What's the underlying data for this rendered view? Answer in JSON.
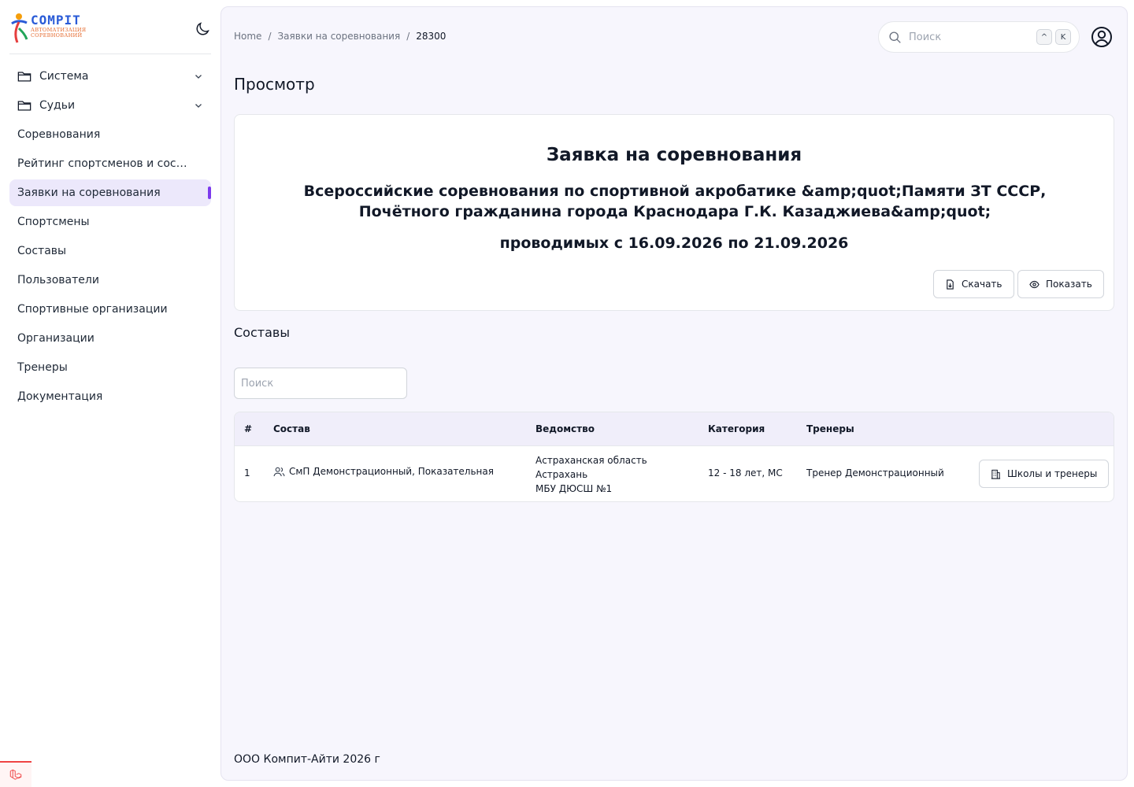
{
  "app": {
    "logo_title": "COMPIT",
    "logo_subtitle_1": "АВТОМАТИЗАЦИЯ",
    "logo_subtitle_2": "СОРЕВНОВАНИЙ"
  },
  "sidebar": {
    "items": [
      {
        "label": "Система",
        "folder": true
      },
      {
        "label": "Судьи",
        "folder": true
      },
      {
        "label": "Соревнования"
      },
      {
        "label": "Рейтинг спортсменов и состав..."
      },
      {
        "label": "Заявки на соревнования",
        "active": true
      },
      {
        "label": "Спортсмены"
      },
      {
        "label": "Составы"
      },
      {
        "label": "Пользователи"
      },
      {
        "label": "Спортивные организации"
      },
      {
        "label": "Организации"
      },
      {
        "label": "Тренеры"
      },
      {
        "label": "Документация"
      }
    ]
  },
  "breadcrumb": {
    "home": "Home",
    "sep": "/",
    "section": "Заявки на соревнования",
    "current": "28300"
  },
  "header": {
    "search_placeholder": "Поиск",
    "kbd_1": "^",
    "kbd_2": "K"
  },
  "page": {
    "title": "Просмотр"
  },
  "card": {
    "heading": "Заявка на соревнования",
    "competition": "Всероссийские соревнования по спортивной акробатике &amp;quot;Памяти ЗТ СССР, Почётного гражданина города Краснодара Г.К. Казаджиева&amp;quot;",
    "dates": "проводимых с 16.09.2026 по 21.09.2026",
    "download_label": "Скачать",
    "show_label": "Показать"
  },
  "teams": {
    "title": "Составы",
    "search_placeholder": "Поиск",
    "columns": [
      "#",
      "Состав",
      "Ведомство",
      "Категория",
      "Тренеры"
    ],
    "rows": [
      {
        "num": "1",
        "team": "СмП Демонстрационный, Показательная",
        "dept_1": "Астраханская область",
        "dept_2": "Астрахань",
        "dept_3": "МБУ ДЮСШ №1",
        "category": "12 - 18 лет, МС",
        "coaches": "Тренер Демонстрационный",
        "action_label": "Школы и тренеры"
      }
    ]
  },
  "footer": {
    "text": "ООО Компит-Айти 2026 г"
  },
  "colors": {
    "accent": "#7c3aed",
    "active_bg": "#ece8fb",
    "main_bg": "#f7f6fd"
  }
}
